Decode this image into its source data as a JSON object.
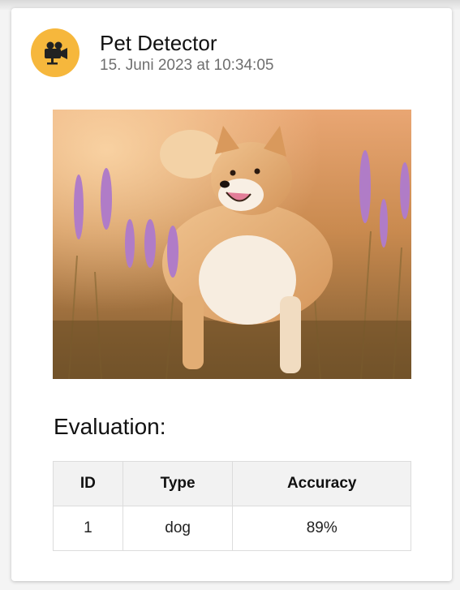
{
  "card": {
    "title": "Pet Detector",
    "timestamp": "15. Juni 2023 at 10:34:05",
    "avatar_icon": "video-camera-icon",
    "avatar_color": "#f6b73c"
  },
  "photo": {
    "subject": "dog"
  },
  "evaluation": {
    "heading": "Evaluation:",
    "columns": [
      "ID",
      "Type",
      "Accuracy"
    ],
    "rows": [
      {
        "id": "1",
        "type": "dog",
        "accuracy": "89%"
      }
    ]
  }
}
